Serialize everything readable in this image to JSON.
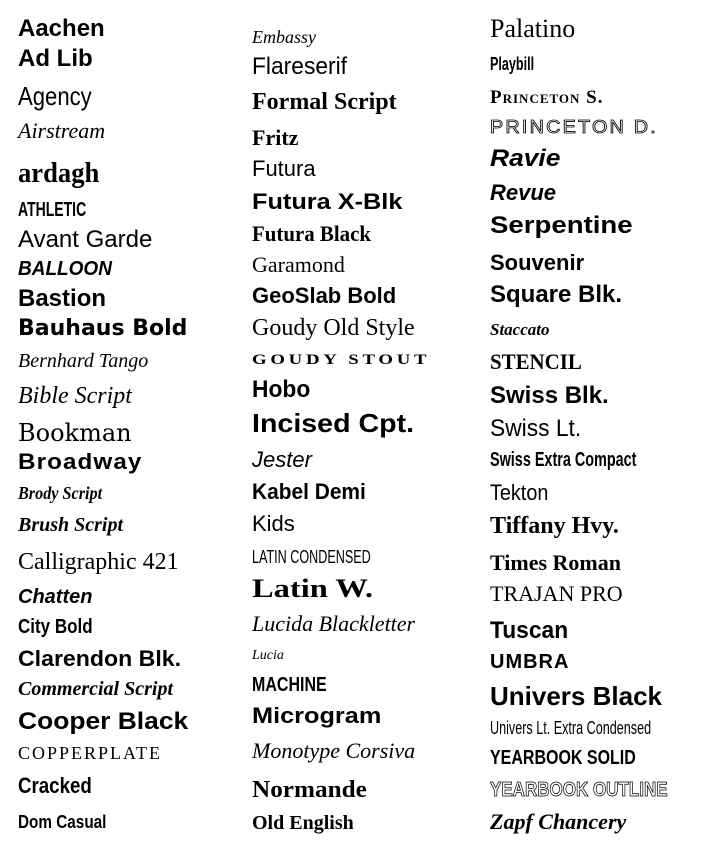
{
  "columns": [
    {
      "fonts": [
        "Aachen",
        "Ad Lib",
        "Agency",
        "Airstream",
        "ardagh",
        "ATHLETIC",
        "Avant Garde",
        "BALLOON",
        "Bastion",
        "Bauhaus Bold",
        "Bernhard Tango",
        "Bible Script",
        "Bookman",
        "Broadway",
        "Brody Script",
        "Brush Script",
        "Calligraphic 421",
        "Chatten",
        "City Bold",
        "Clarendon Blk.",
        "Commercial Script",
        "Cooper Black",
        "Copperplate",
        "Cracked",
        "Dom Casual"
      ]
    },
    {
      "fonts": [
        "Embassy",
        "Flareserif",
        "Formal Script",
        "Fritz",
        "Futura",
        "Futura X-Blk",
        "Futura Black",
        "Garamond",
        "GeoSlab Bold",
        "Goudy Old Style",
        "Goudy Stout",
        "Hobo",
        "Incised Cpt.",
        "Jester",
        "Kabel Demi",
        "Kids",
        "Latin Condensed",
        "Latin W.",
        "Lucida Blackletter",
        "Lucia",
        "Machine",
        "Microgram",
        "Monotype Corsiva",
        "Normande",
        "Old English"
      ]
    },
    {
      "fonts": [
        "Palatino",
        "Playbill",
        "Princeton S.",
        "Princeton D.",
        "Ravie",
        "Revue",
        "Serpentine",
        "Souvenir",
        "Square Blk.",
        "Staccato",
        "Stencil",
        "Swiss Blk.",
        "Swiss Lt.",
        "Swiss Extra Compact",
        "Tekton",
        "Tiffany Hvy.",
        "Times Roman",
        "Trajan Pro",
        "Tuscan",
        "Umbra",
        "Univers Black",
        "Univers Lt. Extra Condensed",
        "Yearbook Solid",
        "Yearbook Outline",
        "Zapf Chancery"
      ]
    }
  ]
}
